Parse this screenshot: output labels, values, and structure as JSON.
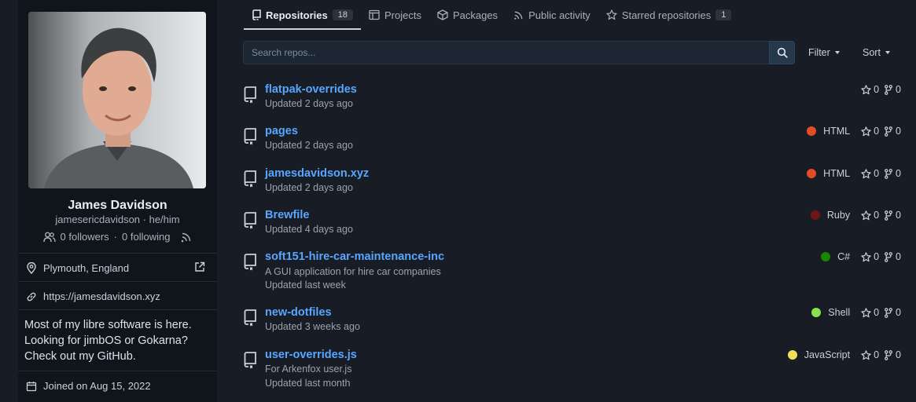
{
  "profile": {
    "name": "James Davidson",
    "handle": "jamesericdavidson · he/him",
    "followers": "0 followers",
    "following": "0 following",
    "dot": "·",
    "location": "Plymouth, England",
    "website": "https://jamesdavidson.xyz",
    "bio": "Most of my libre software is here. Looking for jimbOS or Gokarna? Check out my GitHub.",
    "joined": "Joined on Aug 15, 2022"
  },
  "tabs": [
    {
      "label": "Repositories",
      "count": "18",
      "icon": "repo-icon"
    },
    {
      "label": "Projects",
      "icon": "project-icon"
    },
    {
      "label": "Packages",
      "icon": "package-icon"
    },
    {
      "label": "Public activity",
      "icon": "rss-icon"
    },
    {
      "label": "Starred repositories",
      "count": "1",
      "icon": "star-icon"
    }
  ],
  "search": {
    "placeholder": "Search repos..."
  },
  "controls": {
    "filter": "Filter",
    "sort": "Sort"
  },
  "repos": [
    {
      "name": "flatpak-overrides",
      "desc": "",
      "updated": "Updated 2 days ago",
      "lang": "",
      "color": "",
      "stars": "0",
      "forks": "0"
    },
    {
      "name": "pages",
      "desc": "",
      "updated": "Updated 2 days ago",
      "lang": "HTML",
      "color": "#e34c26",
      "stars": "0",
      "forks": "0"
    },
    {
      "name": "jamesdavidson.xyz",
      "desc": "",
      "updated": "Updated 2 days ago",
      "lang": "HTML",
      "color": "#e34c26",
      "stars": "0",
      "forks": "0"
    },
    {
      "name": "Brewfile",
      "desc": "",
      "updated": "Updated 4 days ago",
      "lang": "Ruby",
      "color": "#701516",
      "stars": "0",
      "forks": "0"
    },
    {
      "name": "soft151-hire-car-maintenance-inc",
      "desc": "A GUI application for hire car companies",
      "updated": "Updated last week",
      "lang": "C#",
      "color": "#178600",
      "stars": "0",
      "forks": "0"
    },
    {
      "name": "new-dotfiles",
      "desc": "",
      "updated": "Updated 3 weeks ago",
      "lang": "Shell",
      "color": "#89e051",
      "stars": "0",
      "forks": "0"
    },
    {
      "name": "user-overrides.js",
      "desc": "For Arkenfox user.js",
      "updated": "Updated last month",
      "lang": "JavaScript",
      "color": "#f1e05a",
      "stars": "0",
      "forks": "0"
    }
  ]
}
